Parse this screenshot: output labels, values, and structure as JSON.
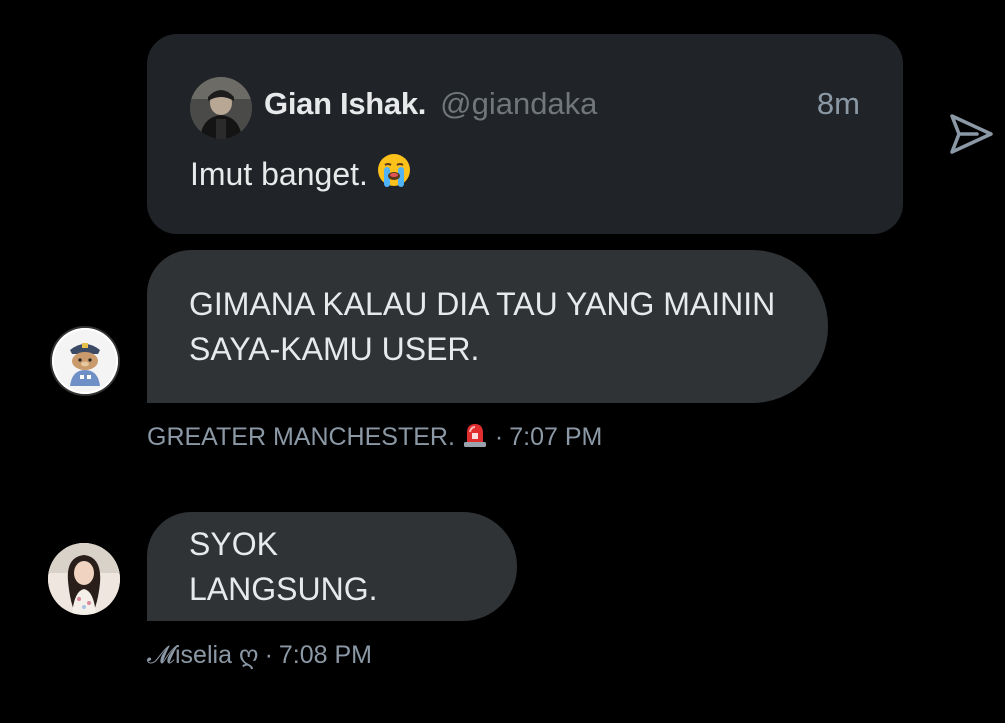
{
  "quoted_tweet": {
    "author_name": "Gian Ishak.",
    "author_handle": "@giandaka",
    "time_ago": "8m",
    "text": "Imut banget.",
    "emoji": "loudly-crying-face-icon"
  },
  "messages": [
    {
      "text": "GIMANA KALAU DIA TAU YANG MAININ SAYA-KAMU USER.",
      "sender_label": "GREATER MANCHESTER.",
      "sender_emoji": "police-light-icon",
      "separator": "·",
      "timestamp": "7:07 PM"
    },
    {
      "text": "SYOK LANGSUNG.",
      "sender_label": "𝓜iselia ღ",
      "separator": "·",
      "timestamp": "7:08 PM"
    }
  ],
  "colors": {
    "background": "#000000",
    "card": "#202327",
    "bubble": "#2f3336",
    "secondary_text": "#8b98a5",
    "primary_text": "#e7e9ea"
  }
}
